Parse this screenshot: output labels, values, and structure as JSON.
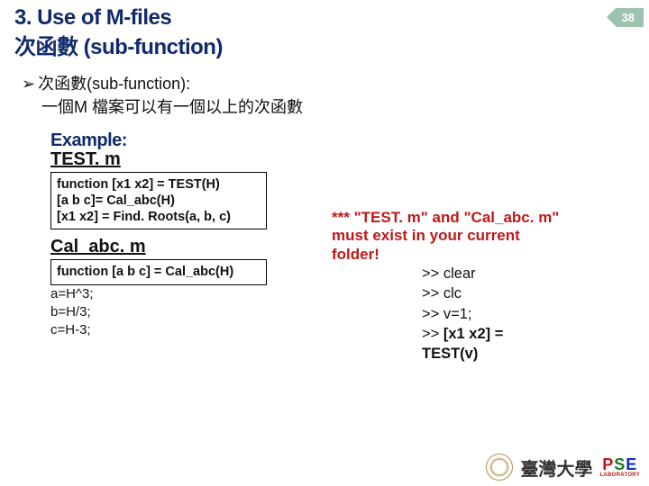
{
  "page": {
    "number": "38"
  },
  "title": {
    "line1": "3. Use of M-files",
    "line2": "次函數 (sub-function)"
  },
  "bullet": {
    "heading": "次函數(sub-function):",
    "sub": "一個M 檔案可以有一個以上的次函數"
  },
  "example": {
    "label": "Example:",
    "file1": "TEST. m",
    "code1": {
      "l1": "function [x1 x2] = TEST(H)",
      "l2": "[a b c]= Cal_abc(H)",
      "l3": "[x1 x2] = Find. Roots(a, b, c)"
    },
    "file2": "Cal_abc. m",
    "code2": {
      "l1": "function [a b c] = Cal_abc(H)"
    },
    "code2body": {
      "l1": "a=H^3;",
      "l2": "b=H/3;",
      "l3": "c=H-3;"
    }
  },
  "note": {
    "l1": "*** \"TEST. m\" and \"Cal_abc. m\"",
    "l2": "must exist in your current",
    "l3": "folder!"
  },
  "cmds": {
    "c1": ">> clear",
    "c2": ">> clc",
    "c3": ">> v=1;",
    "c4a": ">> ",
    "c4b": "[x1 x2] =",
    "c5": "TEST(v)"
  },
  "footer": {
    "uni": "臺灣大學",
    "lab": "LABORATORY"
  }
}
